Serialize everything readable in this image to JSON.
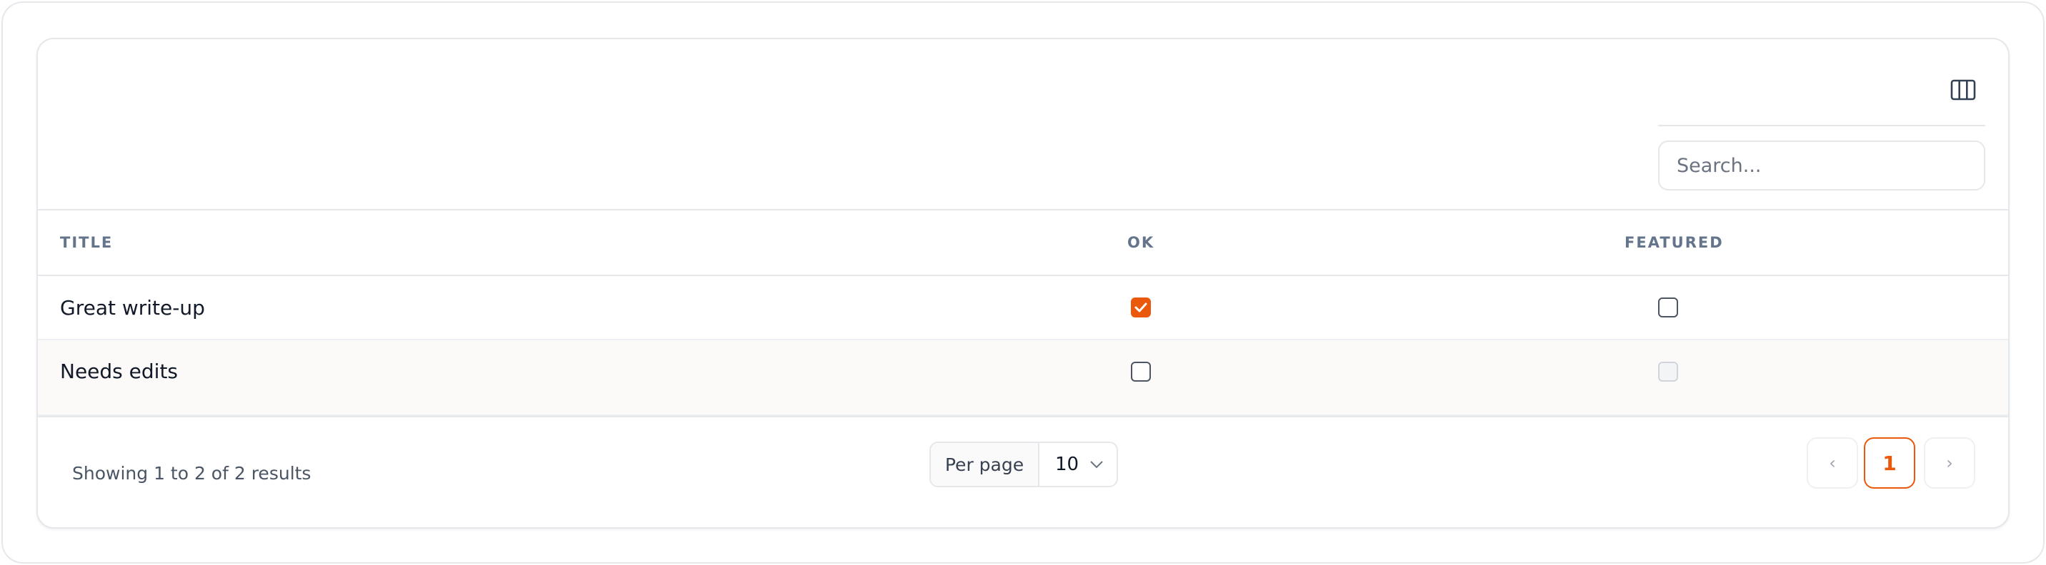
{
  "toolbar": {
    "column_toggle_icon": "columns-icon",
    "search_placeholder": "Search..."
  },
  "table": {
    "headers": {
      "title": "TITLE",
      "ok": "OK",
      "featured": "FEATURED"
    },
    "rows": [
      {
        "title": "Great write-up",
        "ok": true,
        "featured": false,
        "featured_disabled": false
      },
      {
        "title": "Needs edits",
        "ok": false,
        "featured": false,
        "featured_disabled": true
      }
    ]
  },
  "footer": {
    "showing": "Showing 1 to 2 of 2 results",
    "per_page_label": "Per page",
    "per_page_value": "10",
    "pagination": {
      "prev": "‹",
      "current": "1",
      "next": "›"
    }
  },
  "colors": {
    "accent": "#ea580c",
    "border": "#e5e7eb",
    "header_text": "#64748b"
  }
}
